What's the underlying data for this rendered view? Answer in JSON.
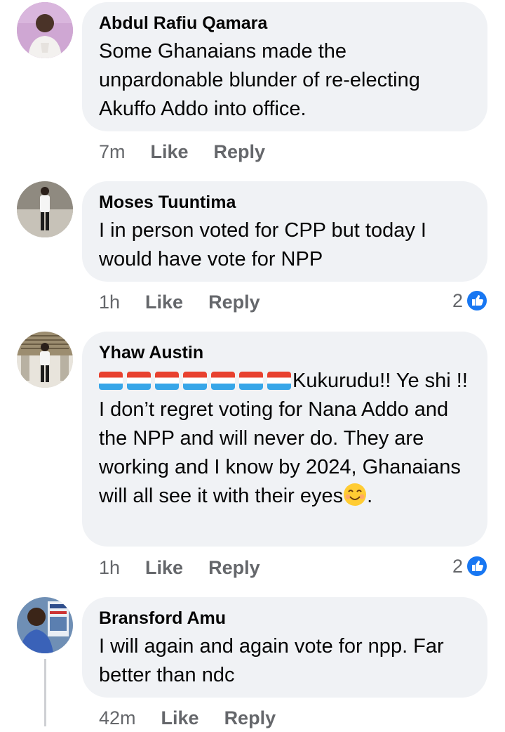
{
  "comments": [
    {
      "author": "Abdul Rafiu Qamara",
      "text": "Some Ghanaians made the unpardonable blunder of re-electing Akuffo Addo into office.",
      "time": "7m",
      "like_label": "Like",
      "reply_label": "Reply"
    },
    {
      "author": "Moses Tuuntima",
      "text": "I in person voted for CPP but today I would have vote for NPP",
      "time": "1h",
      "like_label": "Like",
      "reply_label": "Reply",
      "reaction_count": "2"
    },
    {
      "author": "Yhaw Austin",
      "text_main": "Kukurudu!! Ye shi !! I don’t regret voting for Nana Addo and the NPP and will never do. They are working and I know by 2024, Ghanaians will all see it with their eyes",
      "text_end": ".",
      "emoji_prefix": "flag-emoji x7",
      "emoji_suffix": "smiling-face-emoji",
      "time": "1h",
      "like_label": "Like",
      "reply_label": "Reply",
      "reaction_count": "2"
    },
    {
      "author": "Bransford Amu",
      "text": "I will again and again vote for npp. Far better than ndc",
      "time": "42m",
      "like_label": "Like",
      "reply_label": "Reply"
    }
  ],
  "colors": {
    "bubble": "#f0f2f5",
    "meta_text": "#65676b",
    "like_blue": "#1877f2"
  }
}
